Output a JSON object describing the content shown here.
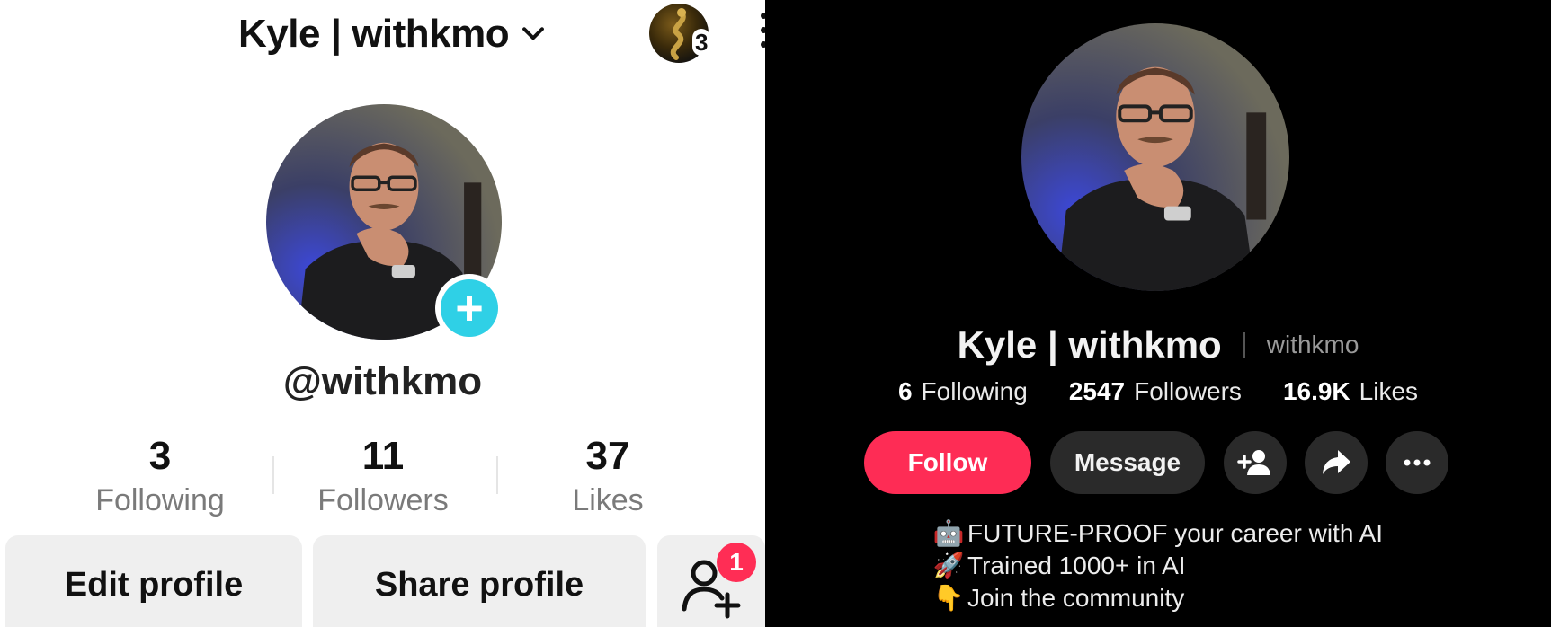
{
  "left_profile": {
    "display_name": "Kyle | withkmo",
    "story_count": "3",
    "handle": "@withkmo",
    "stats": [
      {
        "value": "3",
        "label": "Following"
      },
      {
        "value": "11",
        "label": "Followers"
      },
      {
        "value": "37",
        "label": "Likes"
      }
    ],
    "edit_profile_label": "Edit profile",
    "share_profile_label": "Share profile",
    "friend_requests_badge": "1",
    "icons": [
      "chevron-down-icon",
      "more-vertical-icon",
      "plus-icon",
      "add-friend-icon"
    ],
    "accent_color": "#2fd0e6",
    "badge_color": "#ff2d55"
  },
  "right_profile": {
    "display_name": "Kyle | withkmo",
    "handle": "withkmo",
    "stats": [
      {
        "value": "6",
        "label": "Following"
      },
      {
        "value": "2547",
        "label": "Followers"
      },
      {
        "value": "16.9K",
        "label": "Likes"
      }
    ],
    "follow_label": "Follow",
    "message_label": "Message",
    "bio": [
      {
        "icon": "robot-icon",
        "emoji": "🤖",
        "text": "FUTURE-PROOF your career with AI"
      },
      {
        "icon": "rocket-icon",
        "emoji": "🚀",
        "text": "Trained 1000+ in AI"
      },
      {
        "icon": "pointing-down-icon",
        "emoji": "👇",
        "text": "Join the community"
      }
    ],
    "icons": [
      "add-friend-icon",
      "share-icon",
      "more-horizontal-icon"
    ],
    "accent_color": "#fe2c55"
  }
}
